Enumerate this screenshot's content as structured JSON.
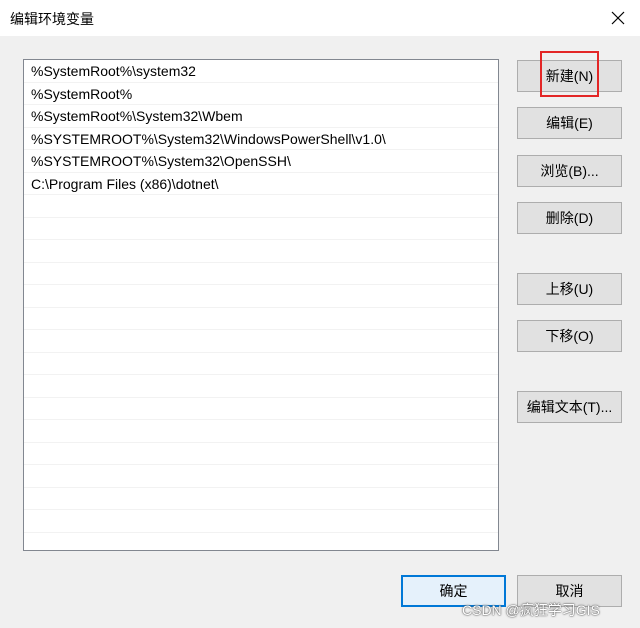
{
  "window": {
    "title": "编辑环境变量",
    "close_icon": "close-icon"
  },
  "path_list": {
    "items": [
      "%SystemRoot%\\system32",
      "%SystemRoot%",
      "%SystemRoot%\\System32\\Wbem",
      "%SYSTEMROOT%\\System32\\WindowsPowerShell\\v1.0\\",
      "%SYSTEMROOT%\\System32\\OpenSSH\\",
      "C:\\Program Files (x86)\\dotnet\\",
      "",
      "",
      "",
      "",
      "",
      "",
      "",
      "",
      "",
      "",
      "",
      "",
      "",
      "",
      "",
      ""
    ]
  },
  "buttons": {
    "new": "新建(N)",
    "edit": "编辑(E)",
    "browse": "浏览(B)...",
    "delete": "删除(D)",
    "move_up": "上移(U)",
    "move_down": "下移(O)",
    "edit_text": "编辑文本(T)...",
    "ok": "确定",
    "cancel": "取消"
  },
  "colors": {
    "highlight_box": "#e32626",
    "default_button_border": "#0078d7"
  },
  "watermark": "CSDN @疯狂学习GIS"
}
